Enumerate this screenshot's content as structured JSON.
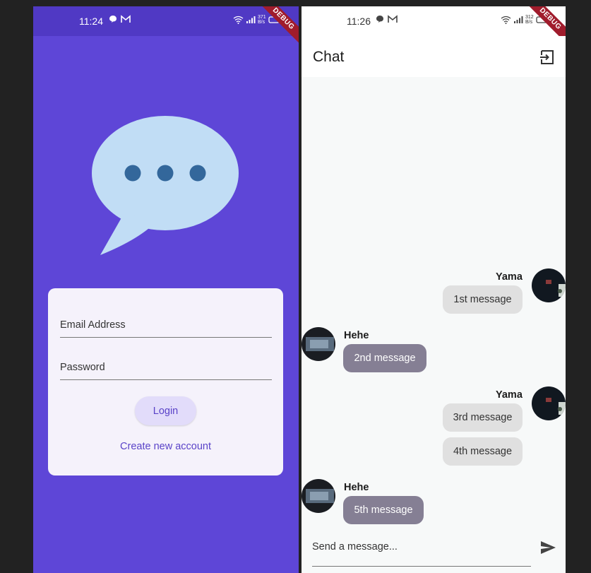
{
  "left_screen": {
    "status": {
      "time": "11:24",
      "speed_value": "371",
      "speed_unit": "B/s"
    },
    "debug_label": "DEBUG",
    "login": {
      "email_label": "Email Address",
      "password_label": "Password",
      "login_button": "Login",
      "create_account_link": "Create new account"
    },
    "colors": {
      "background": "#5e46d7",
      "logo_bubble": "#c1ddf5",
      "logo_dots": "#33679b"
    }
  },
  "right_screen": {
    "status": {
      "time": "11:26",
      "speed_value": "312",
      "speed_unit": "B/s"
    },
    "debug_label": "DEBUG",
    "app_bar": {
      "title": "Chat",
      "logout_icon": "logout-icon"
    },
    "messages": [
      {
        "sender": "Yama",
        "text": "1st message",
        "mine": true
      },
      {
        "sender": "Hehe",
        "text": "2nd message",
        "mine": false
      },
      {
        "sender": "Yama",
        "text": "3rd message",
        "mine": true
      },
      {
        "sender": "",
        "text": "4th message",
        "mine": true
      },
      {
        "sender": "Hehe",
        "text": "5th message",
        "mine": false
      }
    ],
    "composer": {
      "placeholder": "Send a message...",
      "send_icon": "send-icon"
    }
  }
}
